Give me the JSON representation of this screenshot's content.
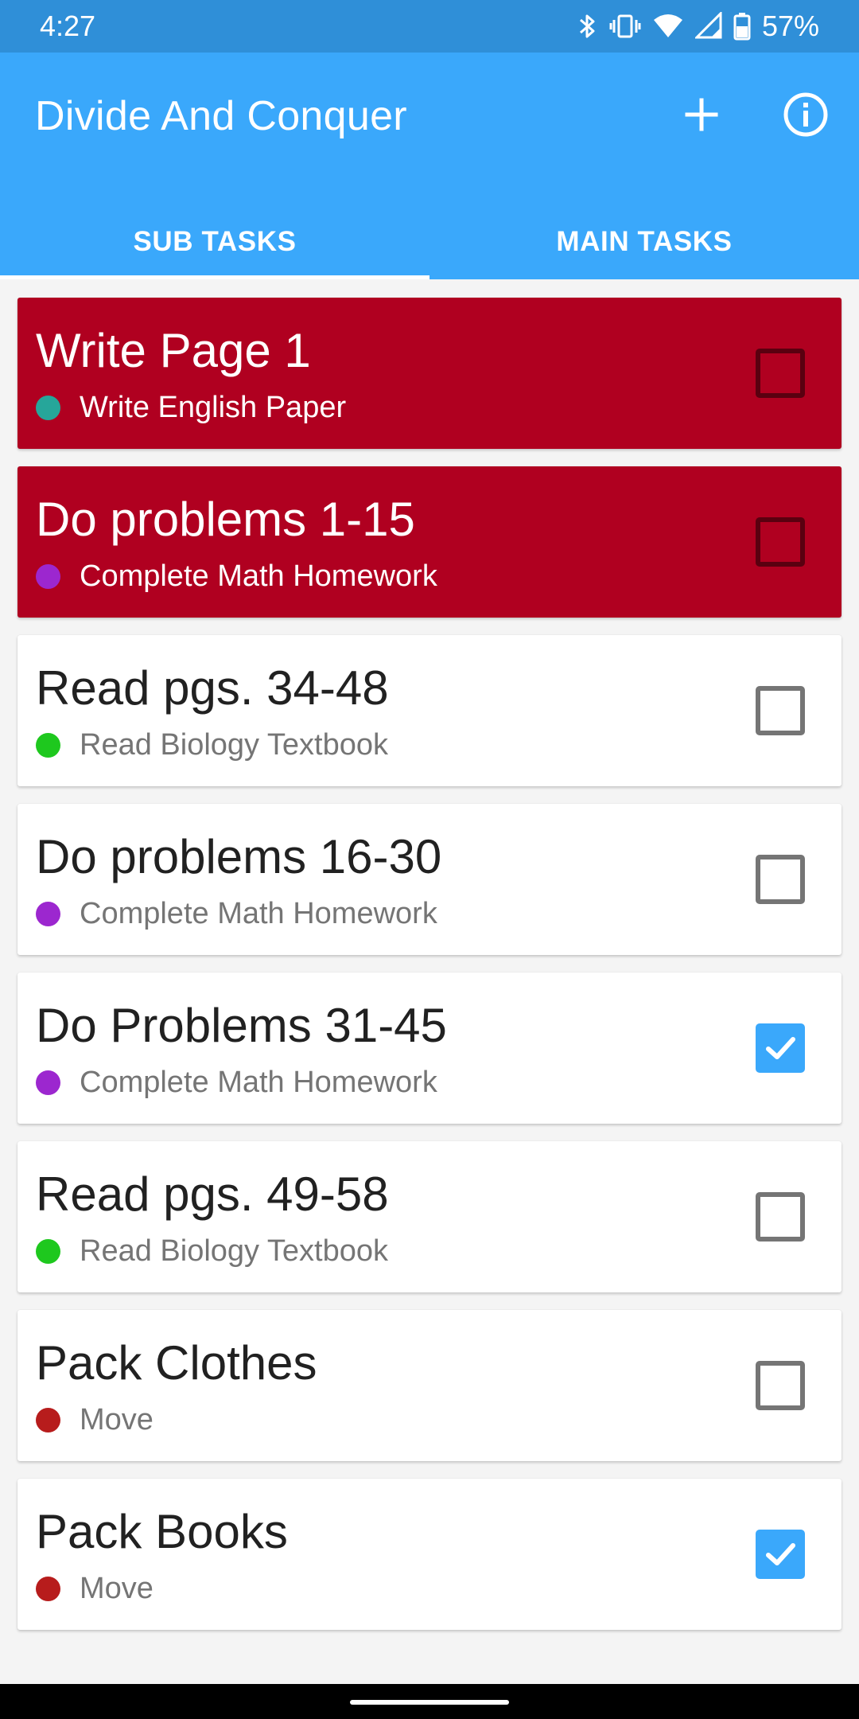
{
  "status_bar": {
    "time": "4:27",
    "battery": "57%",
    "icons": [
      "bluetooth-icon",
      "vibrate-icon",
      "wifi-icon",
      "signal-icon",
      "battery-icon"
    ]
  },
  "app_bar": {
    "title": "Divide And Conquer",
    "actions": [
      "add-icon",
      "info-icon"
    ],
    "color": "#3aa8fb"
  },
  "tabs": [
    {
      "label": "SUB TASKS",
      "active": true
    },
    {
      "label": "MAIN TASKS",
      "active": false
    }
  ],
  "tasks": [
    {
      "title": "Write Page 1",
      "parent": "Write English Paper",
      "dot_color": "#26a69a",
      "checked": false,
      "overdue": true
    },
    {
      "title": "Do problems 1-15",
      "parent": "Complete Math Homework",
      "dot_color": "#9c27cf",
      "checked": false,
      "overdue": true
    },
    {
      "title": "Read pgs. 34-48",
      "parent": "Read Biology Textbook",
      "dot_color": "#1ec81e",
      "checked": false,
      "overdue": false
    },
    {
      "title": "Do problems 16-30",
      "parent": "Complete Math Homework",
      "dot_color": "#9c27cf",
      "checked": false,
      "overdue": false
    },
    {
      "title": "Do Problems 31-45",
      "parent": "Complete Math Homework",
      "dot_color": "#9c27cf",
      "checked": true,
      "overdue": false
    },
    {
      "title": "Read pgs. 49-58",
      "parent": "Read Biology Textbook",
      "dot_color": "#1ec81e",
      "checked": false,
      "overdue": false
    },
    {
      "title": "Pack Clothes",
      "parent": "Move",
      "dot_color": "#b71c1c",
      "checked": false,
      "overdue": false
    },
    {
      "title": "Pack Books",
      "parent": "Move",
      "dot_color": "#b71c1c",
      "checked": true,
      "overdue": false
    }
  ],
  "colors": {
    "overdue_card": "#b00020",
    "checkbox_checked": "#3aa8fb"
  }
}
